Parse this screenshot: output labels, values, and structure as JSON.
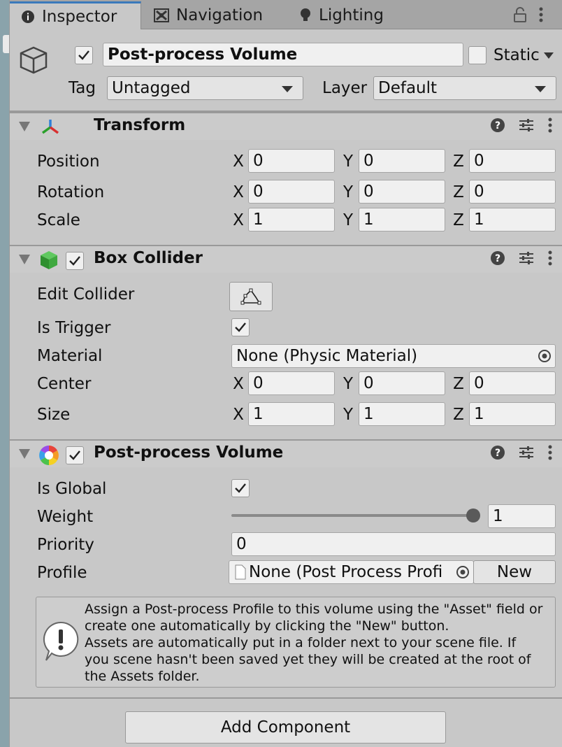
{
  "tabs": [
    {
      "label": "Inspector",
      "icon": "info-icon",
      "active": true
    },
    {
      "label": "Navigation",
      "icon": "navigation-icon",
      "active": false
    },
    {
      "label": "Lighting",
      "icon": "lightbulb-icon",
      "active": false
    }
  ],
  "header": {
    "name": "Post-process Volume",
    "static_label": "Static",
    "tag_label": "Tag",
    "tag_value": "Untagged",
    "layer_label": "Layer",
    "layer_value": "Default"
  },
  "transform": {
    "title": "Transform",
    "rows": [
      {
        "label": "Position",
        "x": "0",
        "y": "0",
        "z": "0"
      },
      {
        "label": "Rotation",
        "x": "0",
        "y": "0",
        "z": "0"
      },
      {
        "label": "Scale",
        "x": "1",
        "y": "1",
        "z": "1"
      }
    ]
  },
  "axes": {
    "x": "X",
    "y": "Y",
    "z": "Z"
  },
  "box_collider": {
    "title": "Box Collider",
    "edit_collider_label": "Edit Collider",
    "is_trigger_label": "Is Trigger",
    "material_label": "Material",
    "material_value": "None (Physic Material)",
    "center": {
      "label": "Center",
      "x": "0",
      "y": "0",
      "z": "0"
    },
    "size": {
      "label": "Size",
      "x": "1",
      "y": "1",
      "z": "1"
    }
  },
  "post_process": {
    "title": "Post-process Volume",
    "is_global_label": "Is Global",
    "weight_label": "Weight",
    "weight_value": "1",
    "weight_fraction": 1.0,
    "priority_label": "Priority",
    "priority_value": "0",
    "profile_label": "Profile",
    "profile_value": "None (Post Process Profi",
    "new_button": "New",
    "help_lines": [
      "Assign a Post-process Profile to this volume using the \"Asset\" field or",
      "create one automatically by clicking the \"New\" button.",
      "Assets are automatically put in a folder next to your scene file. If",
      "you scene hasn't been saved yet they will be created at the root of",
      "the Assets folder."
    ]
  },
  "add_component": "Add Component",
  "colors": {
    "accent": "#3a79bb",
    "panel": "#c8c8c8",
    "field": "#f0f0f0"
  }
}
